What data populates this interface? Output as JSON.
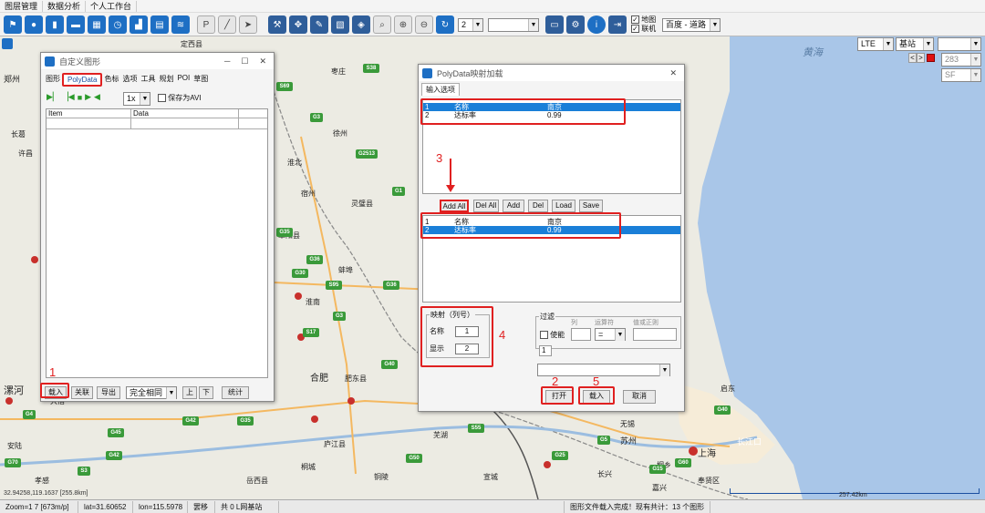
{
  "menubar": {
    "items": [
      "图层管理",
      "数据分析",
      "个人工作台"
    ]
  },
  "toolbar": {
    "zoom_select": "2",
    "map_check_label": "地图",
    "online_check_label": "联机",
    "basemap_select": "百度 - 道路"
  },
  "overlay": {
    "net_select": "LTE",
    "layer_select": "基站",
    "nav_prev": "<",
    "nav_next": ">",
    "id_value": "283",
    "sf_value": "SF",
    "sea_label": "黄海",
    "scale_label": "257.42km"
  },
  "map_labels": {
    "cities": [
      "定西县",
      "枣庄",
      "郑州",
      "长葛",
      "许昌",
      "徐州",
      "淮北",
      "宿州",
      "灵璧县",
      "阜阳县",
      "蚌埠",
      "淮南",
      "合肥",
      "肥东县",
      "庐江县",
      "安陆",
      "孝感",
      "岳西县",
      "桐城",
      "铜陵",
      "宣城",
      "南京",
      "无锡",
      "苏州",
      "上海",
      "长兴",
      "嘉兴",
      "启东",
      "奉贤区",
      "芜湖",
      "漯河",
      "大悟",
      "当涂",
      "桐乡"
    ],
    "roads": [
      "S38",
      "S69",
      "G3",
      "G2513",
      "G1",
      "G36",
      "G35",
      "G30",
      "S95",
      "G36",
      "G3",
      "S17",
      "G42",
      "G40",
      "G4",
      "G45",
      "G70",
      "S3",
      "G42",
      "G35",
      "G50",
      "G25",
      "S55",
      "G5",
      "G60",
      "G15",
      "G40"
    ],
    "yangtze_label": "长江口"
  },
  "custom_window": {
    "title": "自定义图形",
    "tabs": [
      "图形",
      "PolyData",
      "色标",
      "选项",
      "工具",
      "规划",
      "POI",
      "草图"
    ],
    "speed_select": "1x",
    "save_avi_label": "保存为AVI",
    "table_headers": [
      "Item",
      "Data"
    ],
    "bottom_buttons": {
      "load": "载入",
      "link": "关联",
      "export": "导出",
      "match_select": "完全相同",
      "up": "上",
      "down": "下",
      "stats": "统计"
    }
  },
  "poly_window": {
    "title": "PolyData映射加载",
    "tab": "输入选项",
    "top_list": [
      {
        "num": "1",
        "name": "名称",
        "value": "南京"
      },
      {
        "num": "2",
        "name": "达标率",
        "value": "0.99"
      }
    ],
    "buttons": {
      "add_all": "Add All",
      "del_all": "Del All",
      "add": "Add",
      "del": "Del",
      "load": "Load",
      "save": "Save"
    },
    "bottom_list": [
      {
        "num": "1",
        "name": "名称",
        "value": "南京"
      },
      {
        "num": "2",
        "name": "达标率",
        "value": "0.99"
      }
    ],
    "mapping_group": "映射（列号）",
    "mapping_name_label": "名称",
    "mapping_name_value": "1",
    "mapping_show_label": "显示",
    "mapping_show_value": "2",
    "filter_group": "过滤",
    "filter_enable": "使能",
    "filter_col": "列",
    "filter_op": "运算符",
    "filter_val": "值或正则",
    "filter_op_value": "=",
    "filter_num": "1",
    "open_button": "打开",
    "load_button": "载入",
    "cancel_button": "取消"
  },
  "annotations": {
    "n1": "1",
    "n2": "2",
    "n3": "3",
    "n4": "4",
    "n5": "5"
  },
  "statusbar": {
    "zoom": "Zoom=1 7 [673m/p]",
    "lat": "lat=31.60652",
    "lon": "lon=115.5978",
    "mode": "罢移",
    "layers": "共 0 L网基站",
    "message": "图形文件载入完成！现有共计：13 个图形",
    "coord": "32.94258,119.1637 [255.8km]"
  },
  "colors": {
    "accent": "#1a7fd8",
    "road_green": "#3a9a3a",
    "road_red": "#c8302c",
    "annotation_red": "#e02020",
    "water": "#a9c6e8"
  }
}
